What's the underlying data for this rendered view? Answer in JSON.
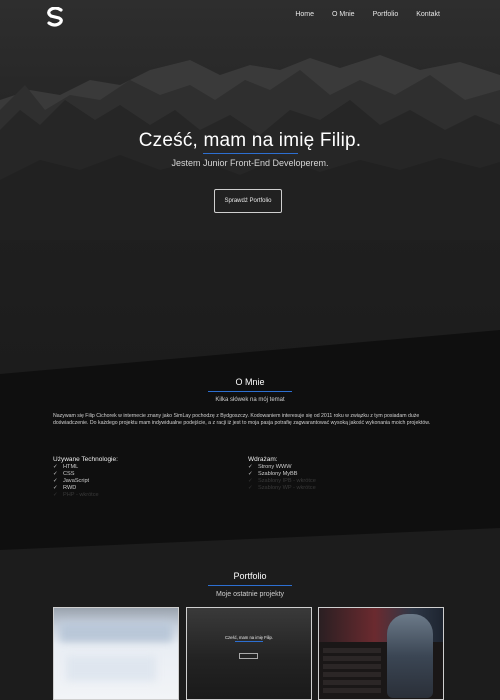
{
  "nav": {
    "logo": "S",
    "items": [
      "Home",
      "O Mnie",
      "Portfolio",
      "Kontakt"
    ]
  },
  "hero": {
    "title": "Cześć, mam na imię Filip.",
    "subtitle": "Jestem Junior Front-End Developerem.",
    "button": "Sprawdź Portfolio"
  },
  "about": {
    "title": "O Mnie",
    "subtitle": "Kilka słówek na mój temat",
    "text": "Nazywam się Filip Cichorek w internecie znany jako SimLay pochodzę z Bydgoszczy. Kodowaniem interesuje się od 2011 roku w związku z tym posiadam duże doświadczenie. Do każdego projektu mam indywidualne podejście, a z racji iż jest to moja pasja potrafię zagwarantować wysoką jakość wykonania moich projektów.",
    "tech_left": {
      "heading": "Używane Technologie:",
      "items": [
        "HTML",
        "CSS",
        "JavaScript",
        "RWD",
        "PHP - wkrótce"
      ],
      "dim_index": 4
    },
    "tech_right": {
      "heading": "Wdrażam:",
      "items": [
        "Strony WWW",
        "Szablony MyBB",
        "Szablony IPB - wkrótce",
        "Szablony WP - wkrótce"
      ],
      "dim_from": 2
    }
  },
  "portfolio": {
    "title": "Portfolio",
    "subtitle": "Moje ostatnie projekty",
    "card2": {
      "title": "Cześć, mam na imię Filip."
    }
  },
  "colors": {
    "accent": "#2d6fd1",
    "bg": "#1c1c1c",
    "band": "#0f0f0f"
  }
}
